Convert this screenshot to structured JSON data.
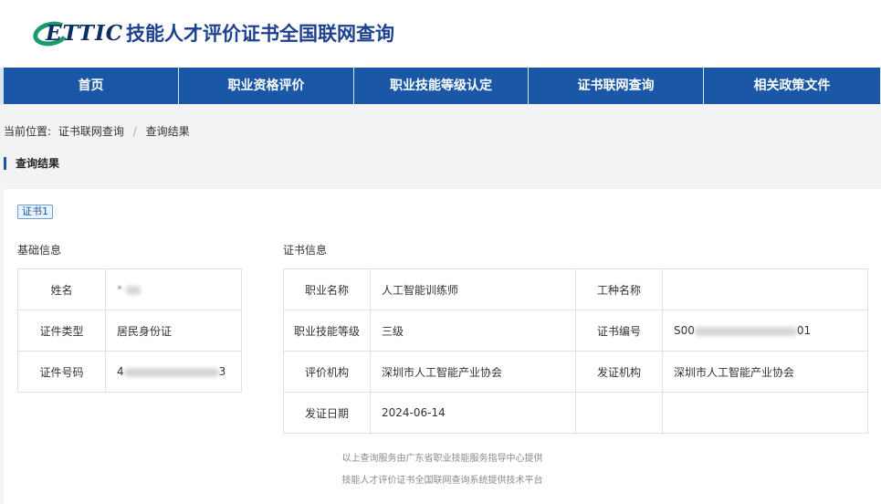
{
  "header": {
    "logo_text": "ETTIC",
    "title": "技能人才评价证书全国联网查询"
  },
  "nav": {
    "items": [
      {
        "label": "首页"
      },
      {
        "label": "职业资格评价"
      },
      {
        "label": "职业技能等级认定"
      },
      {
        "label": "证书联网查询"
      },
      {
        "label": "相关政策文件"
      }
    ]
  },
  "breadcrumb": {
    "prefix": "当前位置:",
    "items": [
      "证书联网查询",
      "查询结果"
    ],
    "separator": "/"
  },
  "section_title": "查询结果",
  "result": {
    "tag": "证书1",
    "basic": {
      "label": "基础信息",
      "rows": [
        {
          "key": "姓名",
          "value": "*"
        },
        {
          "key": "证件类型",
          "value": "居民身份证"
        },
        {
          "key": "证件号码",
          "value_start": "4",
          "value_end": "3"
        }
      ]
    },
    "cert": {
      "label": "证书信息",
      "rows": [
        {
          "k1": "职业名称",
          "v1": "人工智能训练师",
          "k2": "工种名称",
          "v2": ""
        },
        {
          "k1": "职业技能等级",
          "v1": "三级",
          "k2": "证书编号",
          "v2_start": "S00",
          "v2_end": "01"
        },
        {
          "k1": "评价机构",
          "v1": "深圳市人工智能产业协会",
          "k2": "发证机构",
          "v2": "深圳市人工智能产业协会"
        },
        {
          "k1": "发证日期",
          "v1": "2024-06-14",
          "k2": "",
          "v2": ""
        }
      ]
    }
  },
  "footer": {
    "line1": "以上查询服务由广东省职业技能服务指导中心提供",
    "line2": "技能人才评价证书全国联网查询系统提供技术平台"
  },
  "colors": {
    "brand_blue": "#1a57a6",
    "logo_green": "#1b9a6f",
    "title_blue": "#1d4190"
  }
}
